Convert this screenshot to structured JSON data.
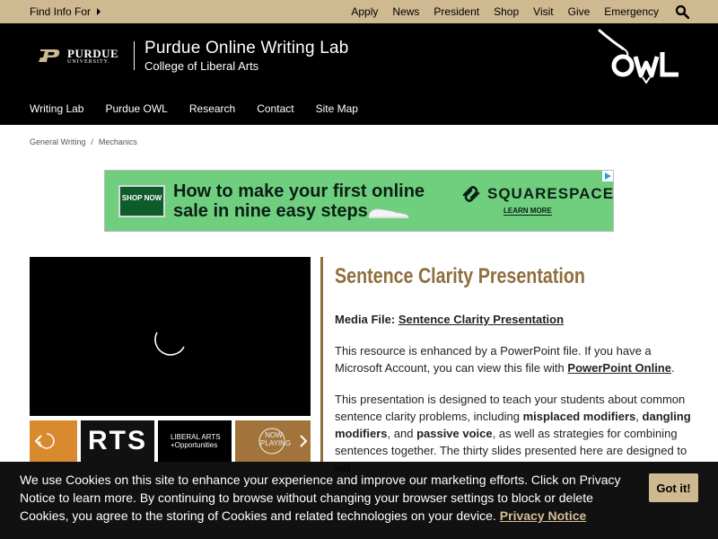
{
  "topbar": {
    "find_info": "Find Info For",
    "links": [
      "Apply",
      "News",
      "President",
      "Shop",
      "Visit",
      "Give",
      "Emergency"
    ]
  },
  "header": {
    "logo_top": "PURDUE",
    "logo_bottom": "UNIVERSITY.",
    "title": "Purdue Online Writing Lab",
    "subtitle": "College of Liberal Arts",
    "owl_text": "OWL",
    "nav": [
      "Writing Lab",
      "Purdue OWL",
      "Research",
      "Contact",
      "Site Map"
    ]
  },
  "breadcrumb": [
    "General Writing",
    "/",
    "Mechanics"
  ],
  "ad": {
    "shop_now": "SHOP NOW",
    "line1": "How to make your first online",
    "line2": "sale in nine easy steps.",
    "brand": "SQUARESPACE",
    "learn_more": "LEARN MORE"
  },
  "video": {
    "thumb2": "RTS",
    "thumb3_line1": "LIBERAL ARTS",
    "thumb3_line2": "+Opportunities",
    "thumb4_line1": "NOW",
    "thumb4_line2": "PLAYING"
  },
  "content": {
    "title": "Sentence Clarity Presentation",
    "media_label": "Media File:",
    "media_link": "Sentence Clarity Presentation",
    "p1_a": "This resource is enhanced by a PowerPoint file. If you have a Microsoft Account, you can view this file with",
    "p1_link": "PowerPoint Online",
    "p1_end": ".",
    "p2_a": "This presentation is designed to teach your students about common sentence clarity problems, including",
    "p2_b1": "misplaced modifiers",
    "p2_c": ",",
    "p2_b2": "dangling modifiers",
    "p2_d": ", and",
    "p2_b3": "passive voice",
    "p2_e": ", as well as strategies for combining sentences together. The thirty slides presented here are designed to aid"
  },
  "cookie": {
    "text": "We use Cookies on this site to enhance your experience and improve our marketing efforts. Click on Privacy Notice to learn more. By continuing to browse without changing your browser settings to block or delete Cookies, you agree to the storing of Cookies and related technologies on your device.",
    "link": "Privacy Notice",
    "button": "Got it!"
  },
  "colors": {
    "gold": "#cfb991",
    "black": "#000000",
    "title_gold": "#8e6f3e",
    "ad_green": "#6fcf7f"
  }
}
